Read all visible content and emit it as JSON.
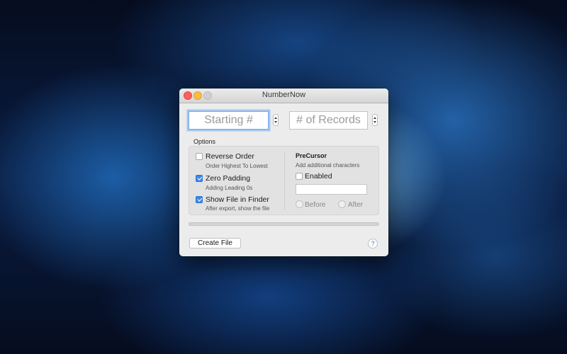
{
  "window": {
    "title": "NumberNow",
    "traffic_lights": [
      "close-icon",
      "minimize-icon",
      "zoom-icon"
    ]
  },
  "fields": {
    "starting_placeholder": "Starting #",
    "records_placeholder": "# of Records"
  },
  "options": {
    "label": "Options",
    "items": [
      {
        "title": "Reverse Order",
        "subtitle": "Order Highest To Lowest",
        "checked": false
      },
      {
        "title": "Zero Padding",
        "subtitle": "Adding Leading 0s",
        "checked": true
      },
      {
        "title": "Show File in Finder",
        "subtitle": "After export, show the file",
        "checked": true
      }
    ]
  },
  "precursor": {
    "title": "PreCursor",
    "subtitle": "Add additional characters",
    "enabled_label": "Enabled",
    "enabled": false,
    "input_value": "",
    "before_label": "Before",
    "after_label": "After"
  },
  "progress": 0,
  "footer": {
    "create_label": "Create File",
    "help_label": "?"
  },
  "colors": {
    "accent": "#3a87ea",
    "focus_ring": "#a5c7f0",
    "close": "#fc605c",
    "minimize": "#fdbc40",
    "zoom": "#cfcfcf"
  }
}
